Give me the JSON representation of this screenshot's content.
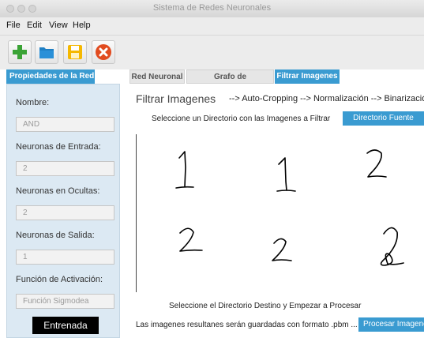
{
  "window": {
    "title": "Sistema de Redes Neuronales"
  },
  "menu": [
    "File",
    "Edit",
    "View",
    "Help"
  ],
  "toolbar": {
    "icons": [
      "add-icon",
      "folder-icon",
      "save-icon",
      "close-icon"
    ],
    "colors": {
      "add": "#3aa335",
      "folder": "#1f7fc4",
      "save": "#f5b800",
      "close": "#e14b1f"
    }
  },
  "left_panel": {
    "tab": "Propiedades de la Red",
    "name_label": "Nombre:",
    "name_value": "AND",
    "input_label": "Neuronas de Entrada:",
    "input_value": "2",
    "hidden_label": "Neuronas en Ocultas:",
    "hidden_value": "2",
    "output_label": "Neuronas de Salida:",
    "output_value": "1",
    "activation_label": "Función de Activación:",
    "activation_value": "Función Sigmodea",
    "status_button": "Entrenada"
  },
  "tabs": [
    {
      "label": "Red Neuronal",
      "active": false
    },
    {
      "label": "Grafo de Entrenamiento",
      "active": false
    },
    {
      "label": "Filtrar Imagenes",
      "active": true
    }
  ],
  "filter": {
    "title": "Filtrar Imagenes",
    "pipeline": "--> Auto-Cropping  --> Normalización  --> Binarización",
    "source_hint": "Seleccione un Directorio con las Imagenes a Filtrar",
    "source_button": "Directorio Fuente",
    "digits": [
      "1",
      "1",
      "2",
      "2",
      "2",
      "2"
    ],
    "dest_hint": "Seleccione el Directorio Destino y Empezar a Procesar",
    "format_note": "Las imagenes resultanes serán guardadas con formato .pbm ...",
    "process_button": "Procesar Imagenes"
  },
  "accent": "#3a9bd1"
}
